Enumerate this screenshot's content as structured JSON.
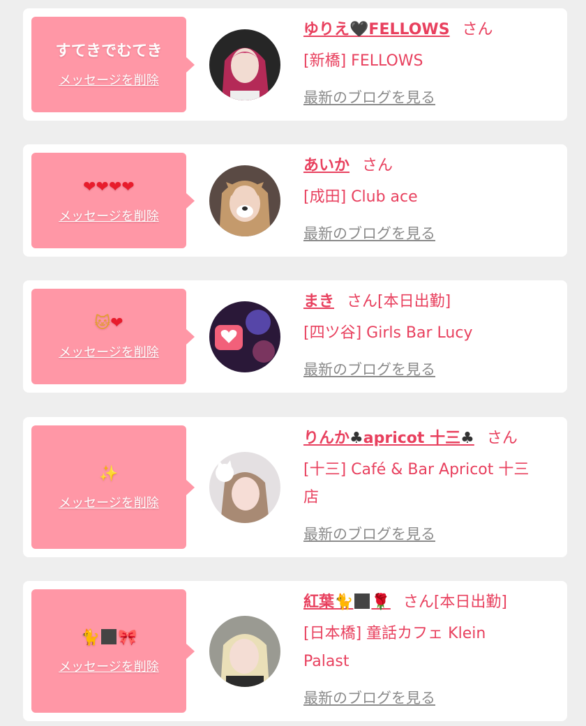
{
  "colors": {
    "bubble": "#ff97a6",
    "name": "#e8405e",
    "link_gray": "#8a8a8a",
    "background": "#eeeeee"
  },
  "delete_label": "メッセージを削除",
  "blog_label": "最新のブログを見る",
  "honorific": "さん",
  "cards": [
    {
      "message": "すてきでむてき",
      "name": "ゆりえ🖤FELLOWS",
      "name_text_a": "ゆりえ",
      "name_icon": "🖤",
      "name_text_b": "FELLOWS",
      "status": "",
      "shop": "[新橋] FELLOWS",
      "avatar": "woman-pink-hair"
    },
    {
      "message": "❤❤❤❤",
      "name": "あいか",
      "status": "",
      "shop": "[成田] Club ace",
      "avatar": "woman-dog-filter"
    },
    {
      "message_icons": [
        "🐱",
        "❤"
      ],
      "name": "まき",
      "status": "[本日出勤]",
      "shop": "[四ツ谷] Girls Bar Lucy",
      "avatar": "neon-heart"
    },
    {
      "message_icon": "✨",
      "name": "りんか♣apricot 十三♣",
      "name_text_a": "りんか",
      "name_icon_a": "♣",
      "name_text_b": "apricot 十三",
      "name_icon_b": "♣",
      "status": "",
      "shop_line1": "[十三] Café & Bar Apricot 十三",
      "shop_line2": "店",
      "avatar": "woman-cat-ears"
    },
    {
      "message_icons": [
        "🐈",
        "⬛",
        "🎀"
      ],
      "name": "紅葉🐈⬛🌹",
      "name_text": "紅葉",
      "name_icons": [
        "🐈",
        "⬛",
        "🌹"
      ],
      "status": "[本日出勤]",
      "shop_line1": "[日本橋] 童話カフェ Klein",
      "shop_line2": "Palast",
      "avatar": "woman-blonde"
    }
  ]
}
